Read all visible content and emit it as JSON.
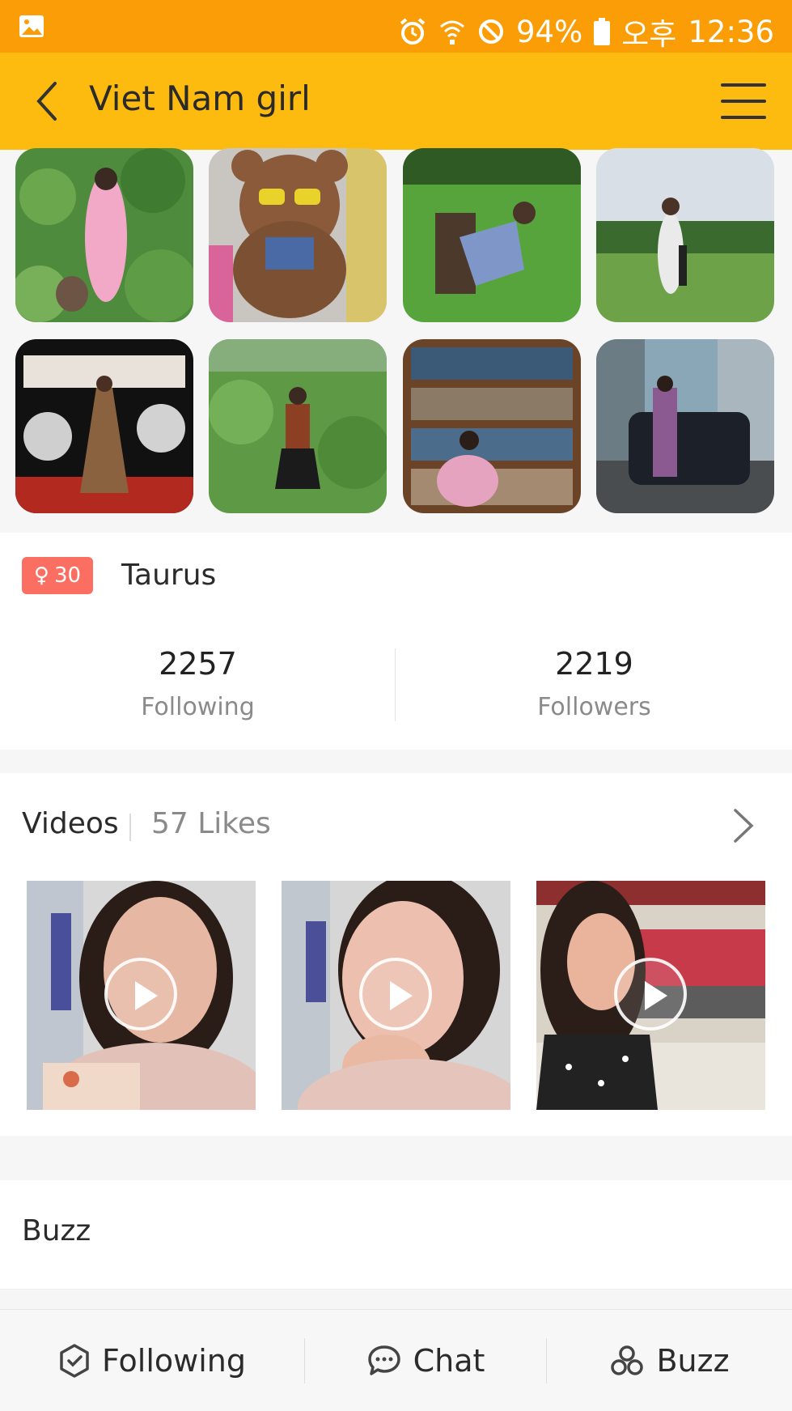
{
  "status_bar": {
    "battery": "94%",
    "clock_prefix": "오후",
    "time": "12:36",
    "icons": [
      "gallery-icon",
      "alarm-icon",
      "wifi-icon",
      "do-not-disturb-icon",
      "battery-icon"
    ]
  },
  "app_bar": {
    "title": "Viet Nam girl",
    "icons": [
      "back-arrow-icon",
      "hamburger-menu-icon"
    ]
  },
  "profile": {
    "gender_symbol": "♀",
    "age": "30",
    "zodiac": "Taurus",
    "following_count": "2257",
    "following_label": "Following",
    "followers_count": "2219",
    "followers_label": "Followers"
  },
  "videos": {
    "title": "Videos",
    "likes": "57 Likes",
    "count": 3
  },
  "buzz": {
    "title": "Buzz"
  },
  "bottom_bar": {
    "tabs": [
      {
        "label": "Following",
        "icon": "shield-check-icon"
      },
      {
        "label": "Chat",
        "icon": "chat-bubble-icon"
      },
      {
        "label": "Buzz",
        "icon": "buzz-circles-icon"
      }
    ]
  },
  "colors": {
    "status_bar": "#fb9d06",
    "app_bar": "#fdbb0f",
    "gender_badge": "#fb6f63"
  }
}
